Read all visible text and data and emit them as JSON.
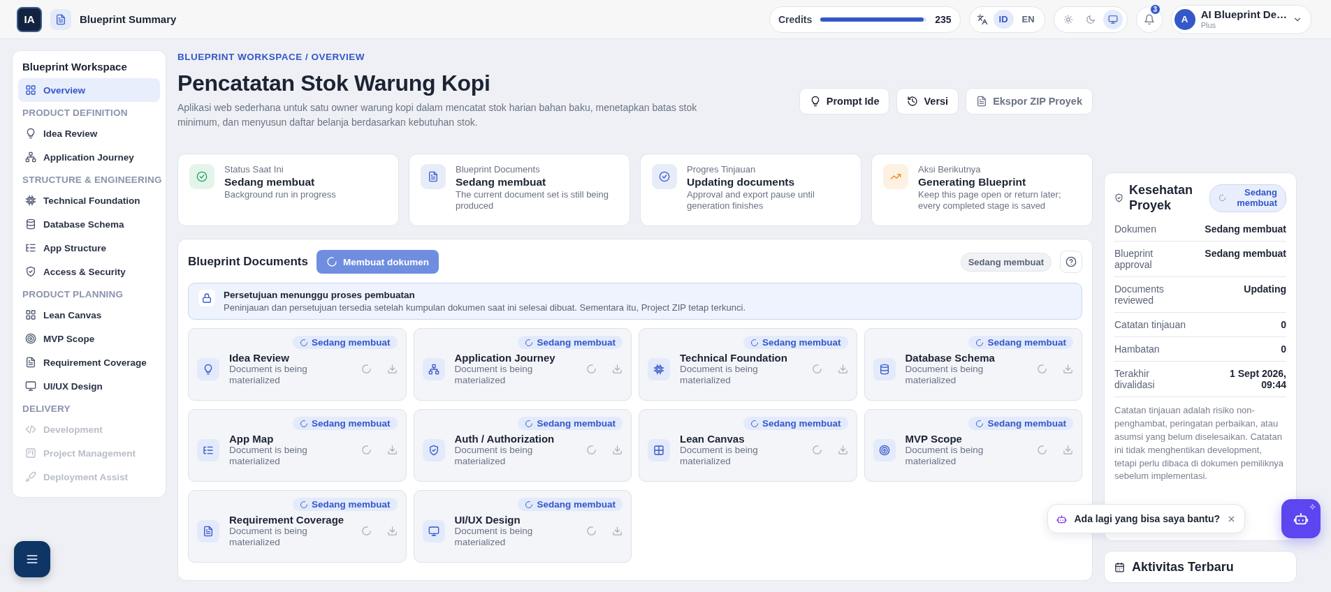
{
  "topbar": {
    "logo": "IA",
    "page_title": "Blueprint Summary",
    "credits": {
      "label": "Credits",
      "level": 0.97,
      "value": "235"
    },
    "languages": [
      {
        "label": "ID",
        "selected": true
      },
      {
        "label": "EN",
        "selected": false
      }
    ],
    "themes": [
      {
        "kind": "light",
        "selected": false
      },
      {
        "kind": "dark",
        "selected": false
      },
      {
        "kind": "system",
        "selected": true
      }
    ],
    "notifications": {
      "badge": "3"
    },
    "user": {
      "avatar": "A",
      "name": "AI Blueprint De…",
      "plan": "Plus"
    }
  },
  "sidebar": {
    "title": "Blueprint Workspace",
    "groups": [
      {
        "items": [
          {
            "label": "Overview",
            "selected": true,
            "disabled": false
          }
        ]
      },
      {
        "heading": "PRODUCT DEFINITION",
        "items": [
          {
            "label": "Idea Review",
            "selected": false,
            "disabled": false
          },
          {
            "label": "Application Journey",
            "selected": false,
            "disabled": false
          }
        ]
      },
      {
        "heading": "STRUCTURE & ENGINEERING",
        "items": [
          {
            "label": "Technical Foundation",
            "selected": false,
            "disabled": false
          },
          {
            "label": "Database Schema",
            "selected": false,
            "disabled": false
          },
          {
            "label": "App Structure",
            "selected": false,
            "disabled": false
          },
          {
            "label": "Access & Security",
            "selected": false,
            "disabled": false
          }
        ]
      },
      {
        "heading": "PRODUCT PLANNING",
        "items": [
          {
            "label": "Lean Canvas",
            "selected": false,
            "disabled": false
          },
          {
            "label": "MVP Scope",
            "selected": false,
            "disabled": false
          },
          {
            "label": "Requirement Coverage",
            "selected": false,
            "disabled": false
          },
          {
            "label": "UI/UX Design",
            "selected": false,
            "disabled": false
          }
        ]
      },
      {
        "heading": "DELIVERY",
        "items": [
          {
            "label": "Development",
            "selected": false,
            "disabled": true
          },
          {
            "label": "Project Management",
            "selected": false,
            "disabled": true
          },
          {
            "label": "Deployment Assist",
            "selected": false,
            "disabled": true
          }
        ]
      }
    ]
  },
  "header": {
    "breadcrumb": "BLUEPRINT WORKSPACE / OVERVIEW",
    "title": "Pencatatan Stok Warung Kopi",
    "description": "Aplikasi web sederhana untuk satu owner warung kopi dalam mencatat stok harian bahan baku, menetapkan batas stok minimum, dan menyusun daftar belanja berdasarkan kebutuhan stok.",
    "actions": [
      {
        "label": "Prompt Ide",
        "disabled": false
      },
      {
        "label": "Versi",
        "disabled": false
      },
      {
        "label": "Ekspor ZIP Proyek",
        "disabled": true
      }
    ]
  },
  "summary_cards": [
    {
      "label": "Status Saat Ini",
      "value": "Sedang membuat",
      "note": "Background run in progress",
      "color": "#22a55b"
    },
    {
      "label": "Blueprint Documents",
      "value": "Sedang membuat",
      "note": "The current document set is still being produced",
      "color": "#3b5fd0"
    },
    {
      "label": "Progres Tinjauan",
      "value": "Updating documents",
      "note": "Approval and export pause until generation finishes",
      "color": "#3b5fd0"
    },
    {
      "label": "Aksi Berikutnya",
      "value": "Generating Blueprint",
      "note": "Keep this page open or return later; every completed stage is saved",
      "color": "#f08a1c"
    }
  ],
  "documents_panel": {
    "title": "Blueprint Documents",
    "generate_button": "Membuat dokumen",
    "status_chip": "Sedang membuat",
    "notice": {
      "title": "Persetujuan menunggu proses pembuatan",
      "text": "Peninjauan dan persetujuan tersedia setelah kumpulan dokumen saat ini selesai dibuat. Sementara itu, Project ZIP tetap terkunci."
    },
    "documents": [
      {
        "title": "Idea Review",
        "status": "Sedang membuat",
        "note": "Document is being materialized"
      },
      {
        "title": "Application Journey",
        "status": "Sedang membuat",
        "note": "Document is being materialized"
      },
      {
        "title": "Technical Foundation",
        "status": "Sedang membuat",
        "note": "Document is being materialized"
      },
      {
        "title": "Database Schema",
        "status": "Sedang membuat",
        "note": "Document is being materialized"
      },
      {
        "title": "App Map",
        "status": "Sedang membuat",
        "note": "Document is being materialized"
      },
      {
        "title": "Auth / Authorization",
        "status": "Sedang membuat",
        "note": "Document is being materialized"
      },
      {
        "title": "Lean Canvas",
        "status": "Sedang membuat",
        "note": "Document is being materialized"
      },
      {
        "title": "MVP Scope",
        "status": "Sedang membuat",
        "note": "Document is being materialized"
      },
      {
        "title": "Requirement Coverage",
        "status": "Sedang membuat",
        "note": "Document is being materialized"
      },
      {
        "title": "UI/UX Design",
        "status": "Sedang membuat",
        "note": "Document is being materialized"
      }
    ]
  },
  "project_health": {
    "title": "Kesehatan Proyek",
    "badge": "Sedang membuat",
    "rows": [
      {
        "label": "Dokumen",
        "value": "Sedang membuat"
      },
      {
        "label": "Blueprint approval",
        "value": "Sedang membuat"
      },
      {
        "label": "Documents reviewed",
        "value": "Updating"
      },
      {
        "label": "Catatan tinjauan",
        "value": "0"
      },
      {
        "label": "Hambatan",
        "value": "0"
      },
      {
        "label": "Terakhir divalidasi",
        "value": "1 Sept 2026, 09:44"
      }
    ],
    "note": "Catatan tinjauan adalah risiko non-penghambat, peringatan perbaikan, atau asumsi yang belum diselesaikan. Catatan ini tidak menghentikan development, tetapi perlu dibaca di dokumen pemiliknya sebelum implementasi."
  },
  "recent_activity": {
    "title": "Aktivitas Terbaru"
  },
  "assistant": {
    "prompt": "Ada lagi yang bisa saya bantu?"
  }
}
